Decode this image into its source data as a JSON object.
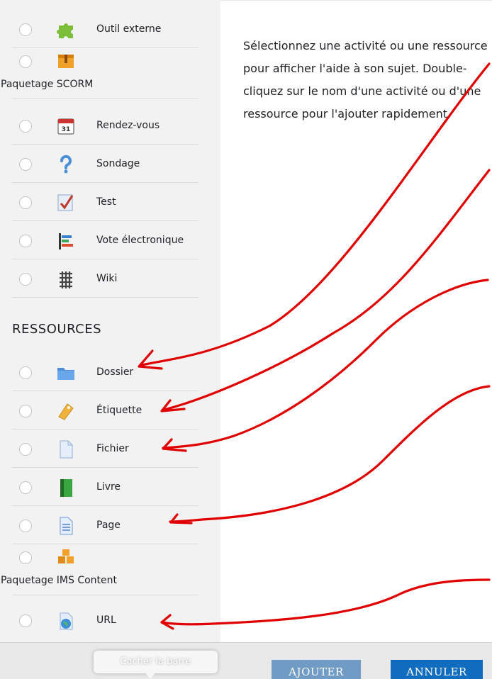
{
  "activities": [
    {
      "label": "Outil externe",
      "icon": "puzzle-piece-icon"
    },
    {
      "label": "Paquetage SCORM",
      "icon": "package-box-icon"
    },
    {
      "label": "Rendez-vous",
      "icon": "calendar-icon",
      "icon_text": "31"
    },
    {
      "label": "Sondage",
      "icon": "question-mark-icon"
    },
    {
      "label": "Test",
      "icon": "checklist-icon"
    },
    {
      "label": "Vote électronique",
      "icon": "bar-chart-icon"
    },
    {
      "label": "Wiki",
      "icon": "wiki-icon"
    }
  ],
  "resources_heading": "RESSOURCES",
  "resources": [
    {
      "label": "Dossier",
      "icon": "folder-icon"
    },
    {
      "label": "Étiquette",
      "icon": "tag-icon"
    },
    {
      "label": "Fichier",
      "icon": "file-icon"
    },
    {
      "label": "Livre",
      "icon": "book-icon"
    },
    {
      "label": "Page",
      "icon": "page-icon"
    },
    {
      "label": "Paquetage IMS Content",
      "icon": "boxes-icon"
    },
    {
      "label": "URL",
      "icon": "globe-icon"
    }
  ],
  "help_text": "Sélectionnez une activité ou une ressource pour afficher l'aide à son sujet. Double-cliquez sur le nom d'une activité ou d'une ressource pour l'ajouter rapidement.",
  "buttons": {
    "add": "AJOUTER",
    "cancel": "ANNULER"
  },
  "tooltip": "Cacher la barre",
  "colors": {
    "primary": "#0f6cbf",
    "primary_disabled": "#6f9bc4",
    "annotation": "#e00000",
    "sidebar": "#f2f2f2"
  }
}
